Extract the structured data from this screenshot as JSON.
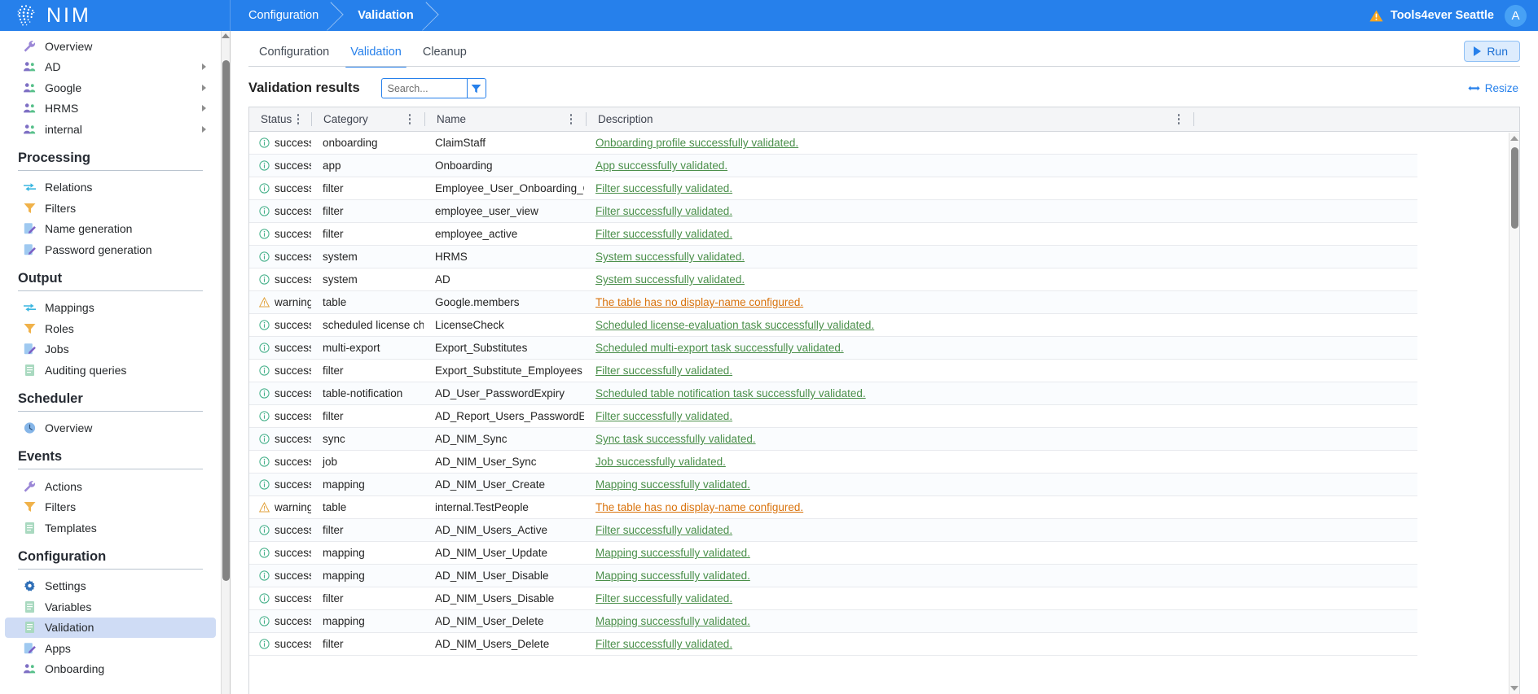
{
  "brand": {
    "name": "NIM",
    "logo_icon": "nim-mesh-logo-icon"
  },
  "breadcrumbs": [
    {
      "label": "Configuration",
      "active": false
    },
    {
      "label": "Validation",
      "active": true
    }
  ],
  "topbar": {
    "tenant_label": "Tools4ever Seattle",
    "tenant_warning_icon": "warning-triangle-icon",
    "avatar_initial": "A"
  },
  "sidebar": {
    "groups": [
      {
        "header": null,
        "items": [
          {
            "label": "Overview",
            "icon": "wrench-icon",
            "expandable": false,
            "selected": false
          },
          {
            "label": "AD",
            "icon": "users-icon",
            "expandable": true,
            "selected": false
          },
          {
            "label": "Google",
            "icon": "users-icon",
            "expandable": true,
            "selected": false
          },
          {
            "label": "HRMS",
            "icon": "users-icon",
            "expandable": true,
            "selected": false
          },
          {
            "label": "internal",
            "icon": "users-icon",
            "expandable": true,
            "selected": false
          }
        ]
      },
      {
        "header": "Processing",
        "items": [
          {
            "label": "Relations",
            "icon": "arrows-exchange-icon",
            "expandable": false,
            "selected": false
          },
          {
            "label": "Filters",
            "icon": "funnel-icon",
            "expandable": false,
            "selected": false
          },
          {
            "label": "Name generation",
            "icon": "page-pencil-icon",
            "expandable": false,
            "selected": false
          },
          {
            "label": "Password generation",
            "icon": "page-pencil-icon",
            "expandable": false,
            "selected": false
          }
        ]
      },
      {
        "header": "Output",
        "items": [
          {
            "label": "Mappings",
            "icon": "arrows-exchange-icon",
            "expandable": false,
            "selected": false
          },
          {
            "label": "Roles",
            "icon": "funnel-icon",
            "expandable": false,
            "selected": false
          },
          {
            "label": "Jobs",
            "icon": "page-pencil-icon",
            "expandable": false,
            "selected": false
          },
          {
            "label": "Auditing queries",
            "icon": "document-icon",
            "expandable": false,
            "selected": false
          }
        ]
      },
      {
        "header": "Scheduler",
        "items": [
          {
            "label": "Overview",
            "icon": "clock-icon",
            "expandable": false,
            "selected": false
          }
        ]
      },
      {
        "header": "Events",
        "items": [
          {
            "label": "Actions",
            "icon": "wrench-icon",
            "expandable": false,
            "selected": false
          },
          {
            "label": "Filters",
            "icon": "funnel-icon",
            "expandable": false,
            "selected": false
          },
          {
            "label": "Templates",
            "icon": "document-icon",
            "expandable": false,
            "selected": false
          }
        ]
      },
      {
        "header": "Configuration",
        "items": [
          {
            "label": "Settings",
            "icon": "gear-icon",
            "expandable": false,
            "selected": false
          },
          {
            "label": "Variables",
            "icon": "document-icon",
            "expandable": false,
            "selected": false
          },
          {
            "label": "Validation",
            "icon": "document-icon",
            "expandable": false,
            "selected": true
          },
          {
            "label": "Apps",
            "icon": "page-pencil-icon",
            "expandable": false,
            "selected": false
          },
          {
            "label": "Onboarding",
            "icon": "users-icon",
            "expandable": false,
            "selected": false
          }
        ]
      }
    ]
  },
  "main": {
    "tabs": [
      {
        "label": "Configuration",
        "active": false
      },
      {
        "label": "Validation",
        "active": true
      },
      {
        "label": "Cleanup",
        "active": false
      }
    ],
    "run_button": {
      "label": "Run",
      "icon": "play-triangle-icon"
    },
    "results_title": "Validation results",
    "search": {
      "value": "",
      "placeholder": "Search..."
    },
    "filter_button_icon": "funnel-icon",
    "resize_link": {
      "label": "Resize",
      "icon": "resize-horizontal-icon"
    }
  },
  "table": {
    "columns": [
      "Status",
      "Category",
      "Name",
      "Description"
    ],
    "rows": [
      {
        "status": "success",
        "category": "onboarding",
        "name": "ClaimStaff",
        "description": "Onboarding profile successfully validated."
      },
      {
        "status": "success",
        "category": "app",
        "name": "Onboarding",
        "description": "App successfully validated."
      },
      {
        "status": "success",
        "category": "filter",
        "name": "Employee_User_Onboarding_QA",
        "description": "Filter successfully validated."
      },
      {
        "status": "success",
        "category": "filter",
        "name": "employee_user_view",
        "description": "Filter successfully validated."
      },
      {
        "status": "success",
        "category": "filter",
        "name": "employee_active",
        "description": "Filter successfully validated."
      },
      {
        "status": "success",
        "category": "system",
        "name": "HRMS",
        "description": "System successfully validated."
      },
      {
        "status": "success",
        "category": "system",
        "name": "AD",
        "description": "System successfully validated."
      },
      {
        "status": "warning",
        "category": "table",
        "name": "Google.members",
        "description": "The table has no display-name configured."
      },
      {
        "status": "success",
        "category": "scheduled license che...",
        "name": "LicenseCheck",
        "description": "Scheduled license-evaluation task successfully validated."
      },
      {
        "status": "success",
        "category": "multi-export",
        "name": "Export_Substitutes",
        "description": "Scheduled multi-export task successfully validated."
      },
      {
        "status": "success",
        "category": "filter",
        "name": "Export_Substitute_Employees",
        "description": "Filter successfully validated."
      },
      {
        "status": "success",
        "category": "table-notification",
        "name": "AD_User_PasswordExpiry",
        "description": "Scheduled table notification task successfully validated."
      },
      {
        "status": "success",
        "category": "filter",
        "name": "AD_Report_Users_PasswordExpiry",
        "description": "Filter successfully validated."
      },
      {
        "status": "success",
        "category": "sync",
        "name": "AD_NIM_Sync",
        "description": "Sync task successfully validated."
      },
      {
        "status": "success",
        "category": "job",
        "name": "AD_NIM_User_Sync",
        "description": "Job successfully validated."
      },
      {
        "status": "success",
        "category": "mapping",
        "name": "AD_NIM_User_Create",
        "description": "Mapping successfully validated."
      },
      {
        "status": "warning",
        "category": "table",
        "name": "internal.TestPeople",
        "description": "The table has no display-name configured."
      },
      {
        "status": "success",
        "category": "filter",
        "name": "AD_NIM_Users_Active",
        "description": "Filter successfully validated."
      },
      {
        "status": "success",
        "category": "mapping",
        "name": "AD_NIM_User_Update",
        "description": "Mapping successfully validated."
      },
      {
        "status": "success",
        "category": "mapping",
        "name": "AD_NIM_User_Disable",
        "description": "Mapping successfully validated."
      },
      {
        "status": "success",
        "category": "filter",
        "name": "AD_NIM_Users_Disable",
        "description": "Filter successfully validated."
      },
      {
        "status": "success",
        "category": "mapping",
        "name": "AD_NIM_User_Delete",
        "description": "Mapping successfully validated."
      },
      {
        "status": "success",
        "category": "filter",
        "name": "AD_NIM_Users_Delete",
        "description": "Filter successfully validated."
      }
    ]
  },
  "colors": {
    "brand_blue": "#2680eb",
    "success_green": "#4a8f4a",
    "warning_orange": "#d9730d",
    "selected_nav": "#cfdcf5"
  }
}
